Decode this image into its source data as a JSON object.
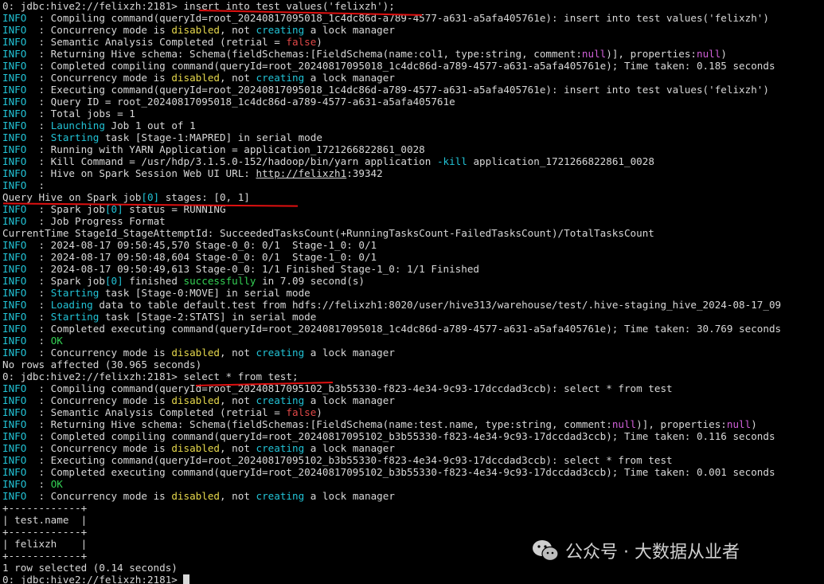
{
  "terminal": {
    "lines": [
      {
        "kind": "prompt",
        "segments": [
          {
            "t": "0: jdbc:hive2://felixzh:2181> insert into test values('felixzh');"
          }
        ]
      },
      {
        "kind": "log",
        "segments": [
          {
            "t": "INFO",
            "c": "info"
          },
          {
            "t": "  : Compiling command(queryId=root_20240817095018_1c4dc86d-a789-4577-a631-a5afa405761e): insert into test values('felixzh')"
          }
        ]
      },
      {
        "kind": "log",
        "segments": [
          {
            "t": "INFO",
            "c": "info"
          },
          {
            "t": "  : Concurrency mode is "
          },
          {
            "t": "disabled",
            "c": "yellow"
          },
          {
            "t": ", not "
          },
          {
            "t": "creating",
            "c": "cyan"
          },
          {
            "t": " a lock manager"
          }
        ]
      },
      {
        "kind": "log",
        "segments": [
          {
            "t": "INFO",
            "c": "info"
          },
          {
            "t": "  : Semantic Analysis Completed (retrial = "
          },
          {
            "t": "false",
            "c": "red"
          },
          {
            "t": ")"
          }
        ]
      },
      {
        "kind": "log",
        "segments": [
          {
            "t": "INFO",
            "c": "info"
          },
          {
            "t": "  : Returning Hive schema: Schema(fieldSchemas:[FieldSchema(name:col1, type:string, comment:"
          },
          {
            "t": "null",
            "c": "magenta"
          },
          {
            "t": ")], properties:"
          },
          {
            "t": "null",
            "c": "magenta"
          },
          {
            "t": ")"
          }
        ]
      },
      {
        "kind": "log",
        "segments": [
          {
            "t": "INFO",
            "c": "info"
          },
          {
            "t": "  : Completed compiling command(queryId=root_20240817095018_1c4dc86d-a789-4577-a631-a5afa405761e); Time taken: 0.185 seconds"
          }
        ]
      },
      {
        "kind": "log",
        "segments": [
          {
            "t": "INFO",
            "c": "info"
          },
          {
            "t": "  : Concurrency mode is "
          },
          {
            "t": "disabled",
            "c": "yellow"
          },
          {
            "t": ", not "
          },
          {
            "t": "creating",
            "c": "cyan"
          },
          {
            "t": " a lock manager"
          }
        ]
      },
      {
        "kind": "log",
        "segments": [
          {
            "t": "INFO",
            "c": "info"
          },
          {
            "t": "  : Executing command(queryId=root_20240817095018_1c4dc86d-a789-4577-a631-a5afa405761e): insert into test values('felixzh')"
          }
        ]
      },
      {
        "kind": "log",
        "segments": [
          {
            "t": "INFO",
            "c": "info"
          },
          {
            "t": "  : Query ID = root_20240817095018_1c4dc86d-a789-4577-a631-a5afa405761e"
          }
        ]
      },
      {
        "kind": "log",
        "segments": [
          {
            "t": "INFO",
            "c": "info"
          },
          {
            "t": "  : Total jobs = 1"
          }
        ]
      },
      {
        "kind": "log",
        "segments": [
          {
            "t": "INFO",
            "c": "info"
          },
          {
            "t": "  : "
          },
          {
            "t": "Launching",
            "c": "cyan"
          },
          {
            "t": " Job 1 out of 1"
          }
        ]
      },
      {
        "kind": "log",
        "segments": [
          {
            "t": "INFO",
            "c": "info"
          },
          {
            "t": "  : "
          },
          {
            "t": "Starting",
            "c": "cyan"
          },
          {
            "t": " task [Stage-1:MAPRED] in serial mode"
          }
        ]
      },
      {
        "kind": "log",
        "segments": [
          {
            "t": "INFO",
            "c": "info"
          },
          {
            "t": "  : Running with YARN Application = application_1721266822861_0028"
          }
        ]
      },
      {
        "kind": "log",
        "segments": [
          {
            "t": "INFO",
            "c": "info"
          },
          {
            "t": "  : Kill Command = /usr/hdp/3.1.5.0-152/hadoop/bin/yarn application "
          },
          {
            "t": "-kill",
            "c": "cyan"
          },
          {
            "t": " application_1721266822861_0028"
          }
        ]
      },
      {
        "kind": "log",
        "segments": [
          {
            "t": "INFO",
            "c": "info"
          },
          {
            "t": "  : Hive on Spark Session Web UI URL: "
          },
          {
            "t": "http://felixzh1",
            "c": "link"
          },
          {
            "t": ":39342"
          }
        ]
      },
      {
        "kind": "log",
        "segments": [
          {
            "t": "INFO",
            "c": "info"
          },
          {
            "t": "  :"
          }
        ]
      },
      {
        "kind": "plain",
        "segments": [
          {
            "t": "Query Hive on Spark job"
          },
          {
            "t": "[0]",
            "c": "cyan"
          },
          {
            "t": " stages: [0, 1]"
          }
        ]
      },
      {
        "kind": "log",
        "segments": [
          {
            "t": "INFO",
            "c": "info"
          },
          {
            "t": "  : Spark job"
          },
          {
            "t": "[0]",
            "c": "cyan"
          },
          {
            "t": " status = RUNNING"
          }
        ]
      },
      {
        "kind": "log",
        "segments": [
          {
            "t": "INFO",
            "c": "info"
          },
          {
            "t": "  : Job Progress Format"
          }
        ]
      },
      {
        "kind": "plain",
        "segments": [
          {
            "t": "CurrentTime StageId_StageAttemptId: SucceededTasksCount(+RunningTasksCount-FailedTasksCount)/TotalTasksCount"
          }
        ]
      },
      {
        "kind": "log",
        "segments": [
          {
            "t": "INFO",
            "c": "info"
          },
          {
            "t": "  : 2024-08-17 09:50:45,570 Stage-0_0: 0/1  Stage-1_0: 0/1"
          }
        ]
      },
      {
        "kind": "log",
        "segments": [
          {
            "t": "INFO",
            "c": "info"
          },
          {
            "t": "  : 2024-08-17 09:50:48,604 Stage-0_0: 0/1  Stage-1_0: 0/1"
          }
        ]
      },
      {
        "kind": "log",
        "segments": [
          {
            "t": "INFO",
            "c": "info"
          },
          {
            "t": "  : 2024-08-17 09:50:49,613 Stage-0_0: 1/1 Finished Stage-1_0: 1/1 Finished"
          }
        ]
      },
      {
        "kind": "log",
        "segments": [
          {
            "t": "INFO",
            "c": "info"
          },
          {
            "t": "  : Spark job"
          },
          {
            "t": "[0]",
            "c": "cyan"
          },
          {
            "t": " finished "
          },
          {
            "t": "successfully",
            "c": "green"
          },
          {
            "t": " in 7.09 second(s)"
          }
        ]
      },
      {
        "kind": "log",
        "segments": [
          {
            "t": "INFO",
            "c": "info"
          },
          {
            "t": "  : "
          },
          {
            "t": "Starting",
            "c": "cyan"
          },
          {
            "t": " task [Stage-0:MOVE] in serial mode"
          }
        ]
      },
      {
        "kind": "log",
        "segments": [
          {
            "t": "INFO",
            "c": "info"
          },
          {
            "t": "  : "
          },
          {
            "t": "Loading",
            "c": "cyan"
          },
          {
            "t": " data to table default.test from hdfs://felixzh1:8020/user/hive313/warehouse/test/.hive-staging_hive_2024-08-17_09"
          }
        ]
      },
      {
        "kind": "log",
        "segments": [
          {
            "t": "INFO",
            "c": "info"
          },
          {
            "t": "  : "
          },
          {
            "t": "Starting",
            "c": "cyan"
          },
          {
            "t": " task [Stage-2:STATS] in serial mode"
          }
        ]
      },
      {
        "kind": "log",
        "segments": [
          {
            "t": "INFO",
            "c": "info"
          },
          {
            "t": "  : Completed executing command(queryId=root_20240817095018_1c4dc86d-a789-4577-a631-a5afa405761e); Time taken: 30.769 seconds"
          }
        ]
      },
      {
        "kind": "log",
        "segments": [
          {
            "t": "INFO",
            "c": "info"
          },
          {
            "t": "  : "
          },
          {
            "t": "OK",
            "c": "green"
          }
        ]
      },
      {
        "kind": "log",
        "segments": [
          {
            "t": "INFO",
            "c": "info"
          },
          {
            "t": "  : Concurrency mode is "
          },
          {
            "t": "disabled",
            "c": "yellow"
          },
          {
            "t": ", not "
          },
          {
            "t": "creating",
            "c": "cyan"
          },
          {
            "t": " a lock manager"
          }
        ]
      },
      {
        "kind": "plain",
        "segments": [
          {
            "t": "No rows affected (30.965 seconds)"
          }
        ]
      },
      {
        "kind": "prompt",
        "segments": [
          {
            "t": "0: jdbc:hive2://felixzh:2181> select * from test;"
          }
        ]
      },
      {
        "kind": "log",
        "segments": [
          {
            "t": "INFO",
            "c": "info"
          },
          {
            "t": "  : Compiling command(queryId=root_20240817095102_b3b55330-f823-4e34-9c93-17dccdad3ccb): select * from test"
          }
        ]
      },
      {
        "kind": "log",
        "segments": [
          {
            "t": "INFO",
            "c": "info"
          },
          {
            "t": "  : Concurrency mode is "
          },
          {
            "t": "disabled",
            "c": "yellow"
          },
          {
            "t": ", not "
          },
          {
            "t": "creating",
            "c": "cyan"
          },
          {
            "t": " a lock manager"
          }
        ]
      },
      {
        "kind": "log",
        "segments": [
          {
            "t": "INFO",
            "c": "info"
          },
          {
            "t": "  : Semantic Analysis Completed (retrial = "
          },
          {
            "t": "false",
            "c": "red"
          },
          {
            "t": ")"
          }
        ]
      },
      {
        "kind": "log",
        "segments": [
          {
            "t": "INFO",
            "c": "info"
          },
          {
            "t": "  : Returning Hive schema: Schema(fieldSchemas:[FieldSchema(name:test.name, type:string, comment:"
          },
          {
            "t": "null",
            "c": "magenta"
          },
          {
            "t": ")], properties:"
          },
          {
            "t": "null",
            "c": "magenta"
          },
          {
            "t": ")"
          }
        ]
      },
      {
        "kind": "log",
        "segments": [
          {
            "t": "INFO",
            "c": "info"
          },
          {
            "t": "  : Completed compiling command(queryId=root_20240817095102_b3b55330-f823-4e34-9c93-17dccdad3ccb); Time taken: 0.116 seconds"
          }
        ]
      },
      {
        "kind": "log",
        "segments": [
          {
            "t": "INFO",
            "c": "info"
          },
          {
            "t": "  : Concurrency mode is "
          },
          {
            "t": "disabled",
            "c": "yellow"
          },
          {
            "t": ", not "
          },
          {
            "t": "creating",
            "c": "cyan"
          },
          {
            "t": " a lock manager"
          }
        ]
      },
      {
        "kind": "log",
        "segments": [
          {
            "t": "INFO",
            "c": "info"
          },
          {
            "t": "  : Executing command(queryId=root_20240817095102_b3b55330-f823-4e34-9c93-17dccdad3ccb): select * from test"
          }
        ]
      },
      {
        "kind": "log",
        "segments": [
          {
            "t": "INFO",
            "c": "info"
          },
          {
            "t": "  : Completed executing command(queryId=root_20240817095102_b3b55330-f823-4e34-9c93-17dccdad3ccb); Time taken: 0.001 seconds"
          }
        ]
      },
      {
        "kind": "log",
        "segments": [
          {
            "t": "INFO",
            "c": "info"
          },
          {
            "t": "  : "
          },
          {
            "t": "OK",
            "c": "green"
          }
        ]
      },
      {
        "kind": "log",
        "segments": [
          {
            "t": "INFO",
            "c": "info"
          },
          {
            "t": "  : Concurrency mode is "
          },
          {
            "t": "disabled",
            "c": "yellow"
          },
          {
            "t": ", not "
          },
          {
            "t": "creating",
            "c": "cyan"
          },
          {
            "t": " a lock manager"
          }
        ]
      },
      {
        "kind": "table",
        "segments": [
          {
            "t": "+------------+"
          }
        ]
      },
      {
        "kind": "table",
        "segments": [
          {
            "t": "| test.name  |"
          }
        ]
      },
      {
        "kind": "table",
        "segments": [
          {
            "t": "+------------+"
          }
        ]
      },
      {
        "kind": "table",
        "segments": [
          {
            "t": "| felixzh    |"
          }
        ]
      },
      {
        "kind": "table",
        "segments": [
          {
            "t": "+------------+"
          }
        ]
      },
      {
        "kind": "plain",
        "segments": [
          {
            "t": "1 row selected (0.14 seconds)"
          }
        ]
      },
      {
        "kind": "prompt",
        "segments": [
          {
            "t": "0: jdbc:hive2://felixzh:2181> "
          }
        ],
        "cursor": true
      }
    ]
  },
  "watermark": {
    "text": "公众号 · 大数据从业者",
    "icon": "wechat-icon"
  },
  "colors": {
    "background": "#000000",
    "text": "#d8d8d8",
    "info": "#22c3d6",
    "yellow": "#e6d84c",
    "red": "#e04848",
    "magenta": "#d060d8",
    "green": "#34d154",
    "annotation": "#e01010"
  }
}
